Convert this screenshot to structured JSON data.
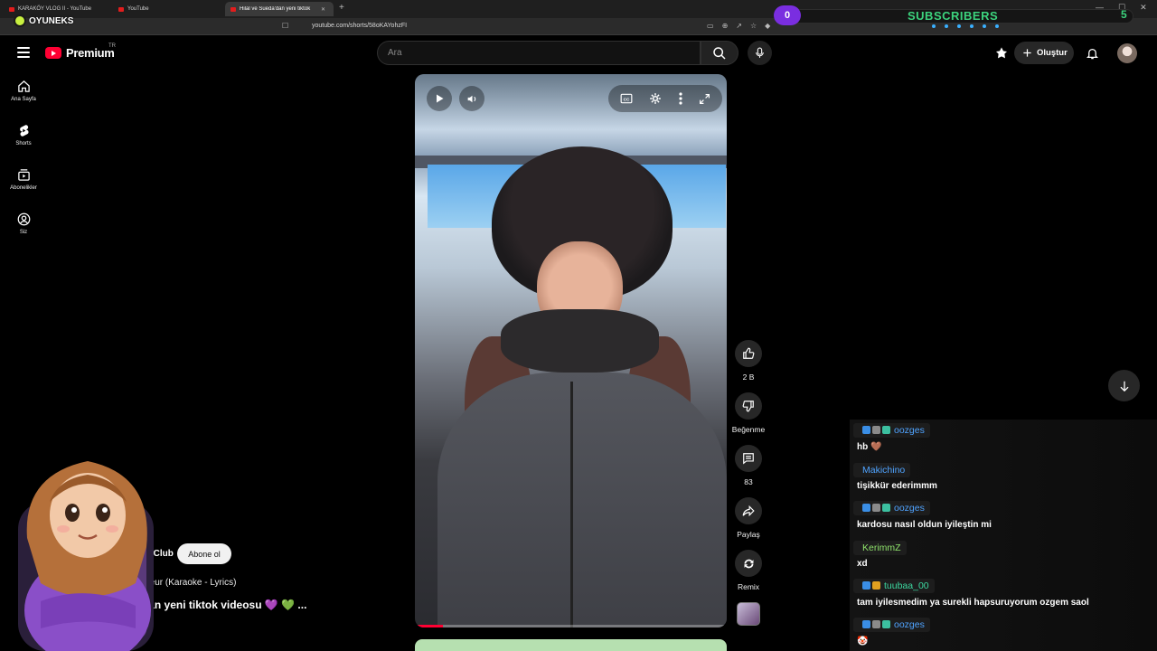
{
  "browser": {
    "tabs": [
      {
        "label": "KARAKÖY VLOG II - YouTube"
      },
      {
        "label": "YouTube"
      },
      {
        "label": "Hilal ve Sueda'dan yeni tiktok"
      }
    ],
    "url": "youtube.com/shorts/58oKAYohzFI",
    "brand": "OYUNEKS"
  },
  "overlay": {
    "subs_count": "0",
    "subs_label": "SUBSCRIBERS",
    "subs_goal": "5"
  },
  "header": {
    "logo_text": "Premium",
    "country": "TR",
    "search_placeholder": "Ara",
    "create_label": "Oluştur"
  },
  "sidebar": {
    "items": [
      {
        "label": "Ana Sayfa",
        "icon": "home-icon"
      },
      {
        "label": "Shorts",
        "icon": "shorts-icon"
      },
      {
        "label": "Abonelikler",
        "icon": "subscriptions-icon"
      },
      {
        "label": "Siz",
        "icon": "you-icon"
      }
    ]
  },
  "video": {
    "progress": 0.09,
    "progress_color": "#ff0033"
  },
  "actions": {
    "like_count": "2 B",
    "dislike_label": "Beğenme",
    "comment_count": "83",
    "share_label": "Paylaş",
    "remix_label": "Remix"
  },
  "meta": {
    "channel": "anClub",
    "subscribe_label": "Abone ol",
    "sound": "mateur (Karaoke - Lyrics)",
    "title": "'dan yeni tiktok videosu 💜 💚  ..."
  },
  "chat": {
    "messages": [
      {
        "user": "oozges",
        "text": "hb 🤎"
      },
      {
        "user": "Makichino",
        "text": "tişikkür ederimmm"
      },
      {
        "user": "oozges",
        "text": "kardosu nasıl oldun iyileştin mi"
      },
      {
        "user": "KerimmZ",
        "text": "xd"
      },
      {
        "user": "tuubaa_00",
        "text": "tam iyilesmedim ya surekli hapsuruyorum ozgem saol"
      },
      {
        "user": "oozges",
        "text": "🤡"
      }
    ]
  }
}
